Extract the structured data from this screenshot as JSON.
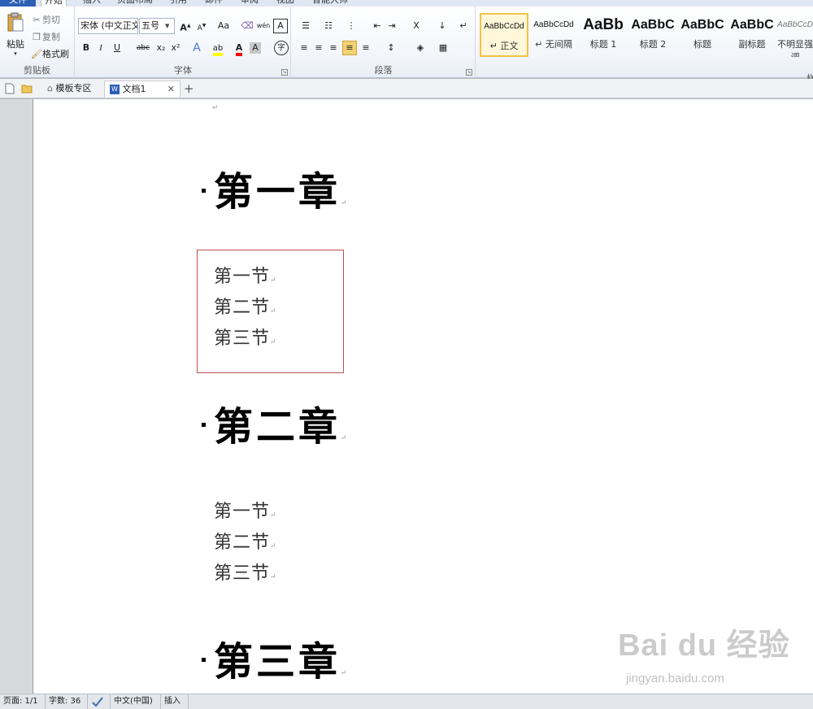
{
  "ribbon_tabs": [
    {
      "label": "文件"
    },
    {
      "label": "开始"
    },
    {
      "label": "插入"
    },
    {
      "label": "页面布局"
    },
    {
      "label": "引用"
    },
    {
      "label": "邮件"
    },
    {
      "label": "审阅"
    },
    {
      "label": "视图"
    },
    {
      "label": "智能大师"
    }
  ],
  "clipboard": {
    "paste": "粘贴",
    "cut": "剪切",
    "copy": "复制",
    "format_painter": "格式刷",
    "group_label": "剪贴板"
  },
  "font": {
    "name_value": "宋体 (中文正文)",
    "size_value": "五号",
    "group_label": "字体",
    "buttons": {
      "bold": "B",
      "italic": "I",
      "underline": "U",
      "strike": "abc",
      "subscript": "x₂",
      "superscript": "x²",
      "grow": "A",
      "shrink": "A",
      "case": "Aa",
      "clear": "⌫",
      "phonetic": "wén",
      "char_border": "A",
      "font_color": "A",
      "char_shade": "A",
      "enclose": "字"
    },
    "colors": {
      "highlight": "#ffff00",
      "font_color": "#ff0000"
    }
  },
  "paragraph": {
    "group_label": "段落",
    "buttons": {
      "bullets": "☰",
      "numbering": "☷",
      "multilevel": "⋮",
      "decrease_indent": "⇤",
      "increase_indent": "⇥",
      "chinese_layout": "X",
      "sort": "↓",
      "show_marks": "↵",
      "align_left": "≡",
      "center": "≡",
      "align_right": "≡",
      "justify": "≡",
      "distributed": "≡",
      "line_spacing": "↕",
      "shading": "◈",
      "borders": "▦"
    }
  },
  "styles": [
    {
      "sample": "AaBbCcDd",
      "name": "↵ 正文",
      "selected": true
    },
    {
      "sample": "AaBbCcDd",
      "name": "↵ 无间隔",
      "selected": false
    },
    {
      "sample": "AaBb",
      "name": "标题 1",
      "selected": false
    },
    {
      "sample": "AaBbC",
      "name": "标题 2",
      "selected": false
    },
    {
      "sample": "AaBbC",
      "name": "标题",
      "selected": false
    },
    {
      "sample": "AaBbC",
      "name": "副标题",
      "selected": false
    },
    {
      "sample": "AaBbCcD",
      "name": "不明显强调",
      "selected": false
    }
  ],
  "styles_group_label": "样",
  "docbar": {
    "template_tab": "模板专区",
    "doc_tab": "文档1",
    "close": "✕",
    "new_tab": "+"
  },
  "document": {
    "top_mark": "↵",
    "headings": [
      {
        "text": "第一章",
        "mark": "↵"
      },
      {
        "text": "第二章",
        "mark": "↵"
      },
      {
        "text": "第三章",
        "mark": "↵"
      }
    ],
    "sections_1": [
      {
        "text": "第一节",
        "mark": "↵"
      },
      {
        "text": "第二节",
        "mark": "↵"
      },
      {
        "text": "第三节",
        "mark": "↵"
      }
    ],
    "sections_2": [
      {
        "text": "第一节",
        "mark": "↵"
      },
      {
        "text": "第二节",
        "mark": "↵"
      },
      {
        "text": "第三节",
        "mark": "↵"
      }
    ]
  },
  "watermark": {
    "logo": "Bai du 经验",
    "url": "jingyan.baidu.com"
  },
  "statusbar": {
    "page": "页面: 1/1",
    "words": "字数: 36",
    "language": "中文(中国)",
    "mode": "插入"
  }
}
